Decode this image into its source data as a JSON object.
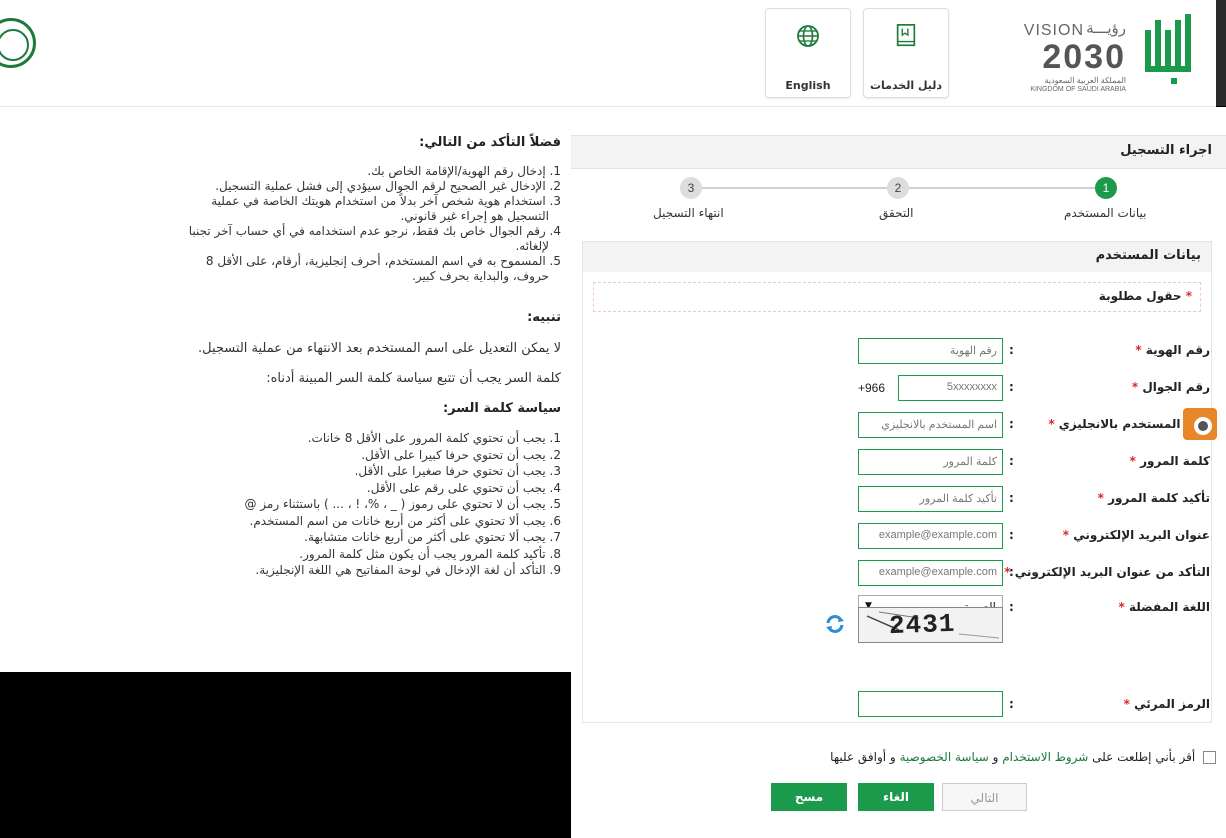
{
  "header": {
    "english_label": "English",
    "services_guide_label": "دليل الخدمات",
    "vision": {
      "vision_word": "VISION",
      "vision_ar": "رؤيـــة",
      "year": "2030",
      "kingdom_ar": "المملكة العربية السعودية",
      "kingdom_en": "KINGDOM OF SAUDI ARABIA"
    }
  },
  "instructions": {
    "title": "فضلاً التأكد من التالي:",
    "items": [
      "1. إدخال رقم الهوية/الإقامة الخاص بك.",
      "2. الإدخال غير الصحيح لرقم الجوال سيؤدي إلى فشل عملية التسجيل.",
      "3. استخدام هوية شخص آخر بدلاً من استخدام هويتك الخاصة في عملية",
      "التسجيل هو إجراء غير قانوني.",
      "4. رقم الجوال خاص بك فقط، نرجو عدم استخدامه في أي حساب آخر تجنبا",
      "لإلغائه.",
      "5. المسموح به في اسم المستخدم، أحرف إنجليزية، أرقام، على الأقل 8",
      "حروف، والبداية بحرف كبير."
    ],
    "warning_title": "تنبيه:",
    "warning_text": "لا يمكن التعديل على اسم المستخدم بعد الانتهاء من عملية التسجيل.",
    "password_note": "كلمة السر يجب أن تتبع سياسة كلمة السر المبينة أدناه:",
    "policy_title": "سياسة كلمة السر:",
    "policy_items": [
      "1. يجب أن تحتوي كلمة المرور على الأقل 8 خانات.",
      "2. يجب أن تحتوي حرفا كبيرا على الأقل.",
      "3. يجب أن تحتوي حرفا صغيرا على الأقل.",
      "4. يجب أن تحتوي على رقم على الأقل.",
      "5. يجب أن لا تحتوي على رموز ( _ ، %، ! ، ... ) باستثناء رمز @",
      "6. يجب ألا تحتوي على أكثر من أربع خانات من اسم المستخدم.",
      "7. يجب ألا تحتوي على أكثر من أربع خانات متشابهة.",
      "8. تأكيد كلمة المرور يجب أن يكون مثل كلمة المرور.",
      "9. التأكد أن لغة الإدخال في لوحة المفاتيح هي اللغة الإنجليزية."
    ]
  },
  "registration": {
    "title": "اجراء التسجيل",
    "steps": [
      {
        "number": "1",
        "label": "بيانات المستخدم",
        "active": true
      },
      {
        "number": "2",
        "label": "التحقق",
        "active": false
      },
      {
        "number": "3",
        "label": "انتهاء التسجيل",
        "active": false
      }
    ],
    "form_title": "بيانات المستخدم",
    "required_note": "حقول مطلوبة",
    "required_star": "*",
    "colon": ":",
    "fields": {
      "id": {
        "label": "رقم الهوية",
        "placeholder": "رقم الهوية"
      },
      "mobile": {
        "label": "رقم الجوال",
        "placeholder": "5xxxxxxxx",
        "prefix": "+966"
      },
      "username": {
        "label": "اسم المستخدم بالانجليزي",
        "placeholder": "اسم المستخدم بالانجليزي"
      },
      "password": {
        "label": "كلمة المرور",
        "placeholder": "كلمة المرور"
      },
      "confirm_password": {
        "label": "تأكيد كلمة المرور",
        "placeholder": "تأكيد كلمة المرور"
      },
      "email": {
        "label": "عنوان البريد الإلكتروني",
        "placeholder": "example@example.com"
      },
      "confirm_email": {
        "label": "التأكد من عنوان البريد الإلكتروني",
        "placeholder": "example@example.com"
      },
      "language": {
        "label": "اللغة المفضلة",
        "value": "العربية"
      },
      "captcha": {
        "label": "الرمز المرئي",
        "image_text": "2431",
        "value": ""
      }
    },
    "agree": {
      "prefix": "أقر بأني إطلعت على",
      "terms_link": "شروط الاستخدام",
      "and": "و",
      "privacy_link": "سياسة الخصوصية",
      "suffix": "و أوافق عليها"
    },
    "buttons": {
      "next": "التالي",
      "cancel": "الغاء",
      "clear": "مسح"
    }
  },
  "colors": {
    "primary_green": "#1c9a4c",
    "required_red": "#d9262c",
    "link_green": "#1c7a3a"
  }
}
